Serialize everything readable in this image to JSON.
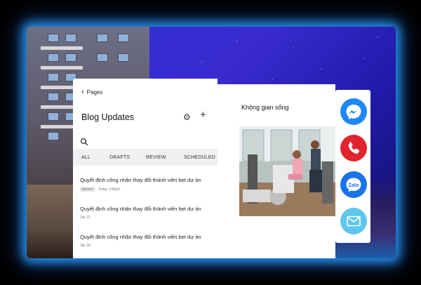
{
  "app": {
    "back_label": "Pages",
    "title": "Blog Updates"
  },
  "tabs": [
    {
      "label": "ALL",
      "active": true
    },
    {
      "label": "DRAFTS",
      "active": false
    },
    {
      "label": "REVIEW",
      "active": false
    },
    {
      "label": "SCHEDULED",
      "active": false
    }
  ],
  "posts": [
    {
      "title": "Quyết định công nhận thay đổi thành viên bẹt dự án",
      "badge": "DRAFT",
      "meta": "Today 1:45pm"
    },
    {
      "title": "Quyết định công nhận thay đổi thành viên bẹt dự án",
      "badge": "",
      "meta": "Jan 11"
    },
    {
      "title": "Quyết định công nhận thay đổi thành viên bẹt dự án",
      "badge": "",
      "meta": "Jan 10"
    }
  ],
  "preview": {
    "heading": "Không gian sống"
  },
  "contact": {
    "colors": {
      "messenger": "#1e88f5",
      "phone": "#e0232d",
      "zalo": "#1a73e8",
      "email": "#5fc6ee"
    },
    "zalo_label": "Zalo"
  },
  "colors": {
    "glow": "#2aa0ff",
    "sky": "#2c2fd8"
  }
}
